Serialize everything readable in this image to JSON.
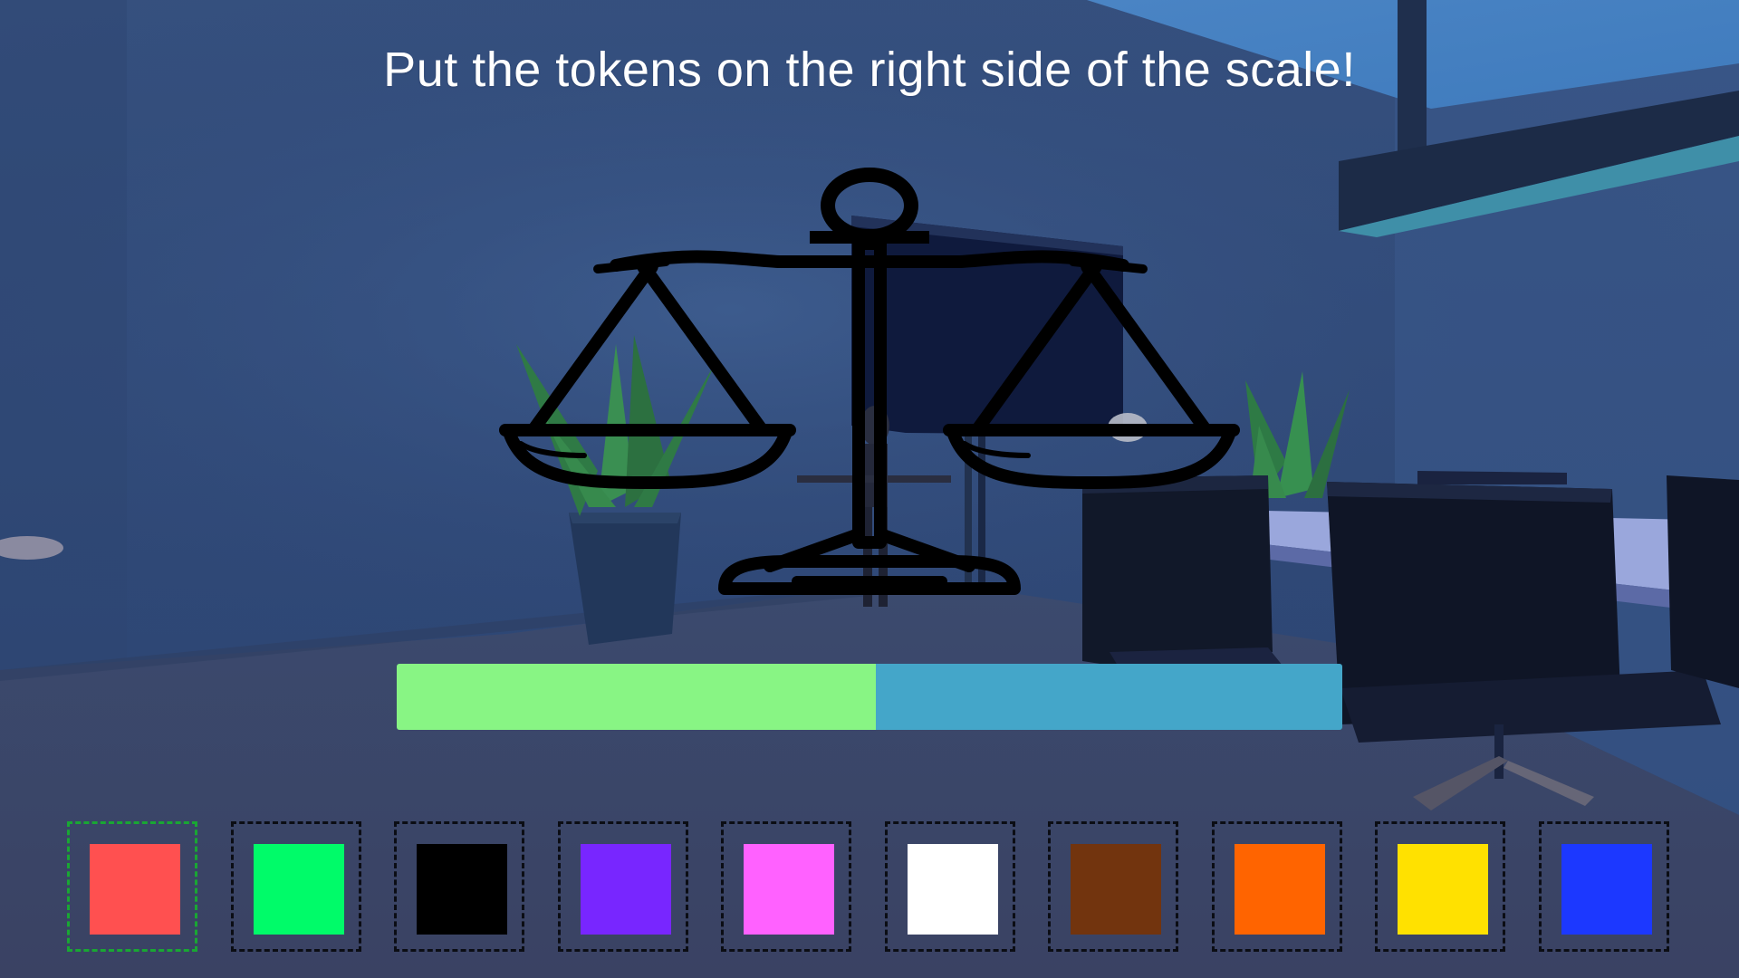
{
  "instruction": "Put the tokens on the right side of the scale!",
  "balance": {
    "left_fraction": 0.507,
    "left_color": "#88f584",
    "right_color": "#44a6c9"
  },
  "tokens": [
    {
      "color": "#ff5050",
      "selected": true
    },
    {
      "color": "#00fb69",
      "selected": false
    },
    {
      "color": "#000000",
      "selected": false
    },
    {
      "color": "#7826ff",
      "selected": false
    },
    {
      "color": "#ff61ff",
      "selected": false
    },
    {
      "color": "#ffffff",
      "selected": false
    },
    {
      "color": "#72340e",
      "selected": false
    },
    {
      "color": "#ff6400",
      "selected": false
    },
    {
      "color": "#ffe100",
      "selected": false
    },
    {
      "color": "#1c38ff",
      "selected": false
    }
  ],
  "icons": {
    "scale": "balance-scale-icon"
  }
}
